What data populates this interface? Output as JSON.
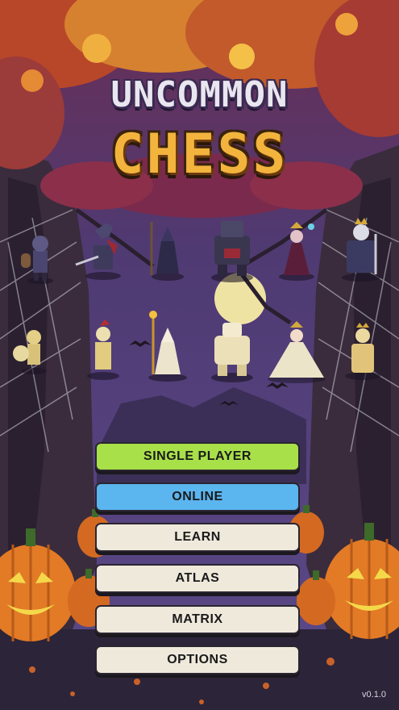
{
  "app": {
    "title_line1": "UNCOMMON",
    "title_line2": "CHESS",
    "version": "v0.1.0"
  },
  "menu": [
    {
      "label": "SINGLE PLAYER",
      "color": "#a8e04a",
      "name": "single-player-button"
    },
    {
      "label": "ONLINE",
      "color": "#5bb5ef",
      "name": "online-button"
    },
    {
      "label": "LEARN",
      "color": "#efe9dc",
      "name": "learn-button"
    },
    {
      "label": "ATLAS",
      "color": "#efe9dc",
      "name": "atlas-button"
    },
    {
      "label": "MATRIX",
      "color": "#efe9dc",
      "name": "matrix-button"
    },
    {
      "label": "OPTIONS",
      "color": "#efe9dc",
      "name": "options-button"
    }
  ],
  "palette": {
    "sky": "#4b3a6b",
    "moon": "#efe3a4",
    "leaves": "#c8622a",
    "trunk": "#3a2c3c",
    "pumpkin": "#e27a26"
  }
}
